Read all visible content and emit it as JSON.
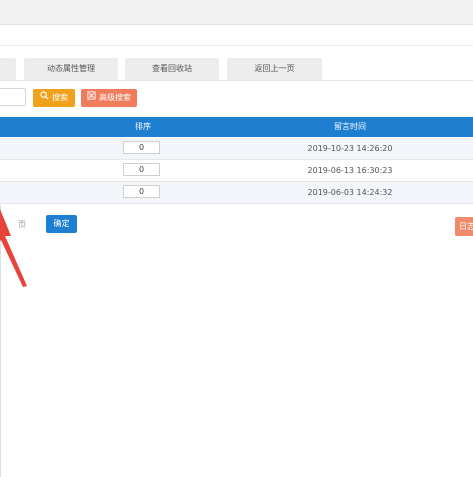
{
  "tabs": [
    {
      "label": "动态属性管理"
    },
    {
      "label": "查看回收站"
    },
    {
      "label": "返回上一页"
    }
  ],
  "toolbar": {
    "search_label": "搜索",
    "advanced_search_label": "高级搜索"
  },
  "table": {
    "headers": {
      "sort": "排序",
      "time": "留言时间"
    },
    "rows": [
      {
        "sort": "0",
        "time": "2019-10-23 14:26:20"
      },
      {
        "sort": "0",
        "time": "2019-06-13 16:30:23"
      },
      {
        "sort": "0",
        "time": "2019-06-03 14:24:32"
      }
    ]
  },
  "pagination": {
    "page_unit": "页",
    "confirm_label": "确定"
  },
  "right_button_label": "日志",
  "colors": {
    "primary": "#1e7fd0",
    "search": "#f0a21c",
    "advanced": "#ef7d5c",
    "arrow": "#e8433b"
  }
}
